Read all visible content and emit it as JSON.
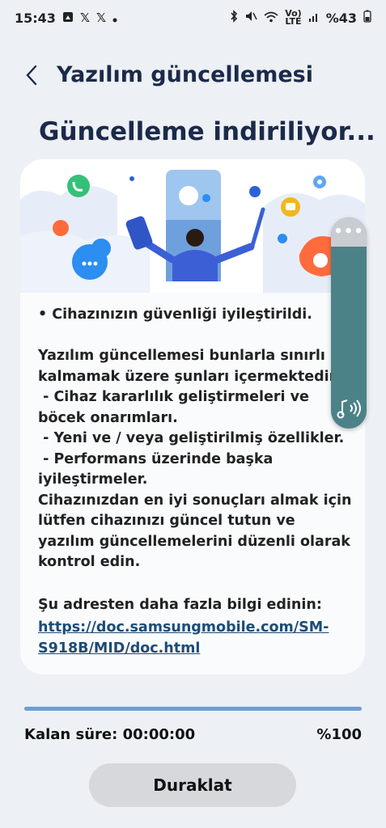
{
  "status_bar": {
    "time": "15:43",
    "battery_percent": "%43",
    "network_label_top": "Vo)",
    "network_label_bottom": "LTE",
    "icons": [
      "photo-icon",
      "x-app-icon",
      "x-app-icon",
      "dot-icon",
      "bluetooth-icon",
      "mute-icon",
      "wifi-icon",
      "signal-icon",
      "battery-icon"
    ]
  },
  "header": {
    "back_icon": "chevron-left-icon",
    "title": "Yazılım güncellemesi"
  },
  "main": {
    "status_heading": "Güncelleme indiriliyor...",
    "description": "• Cihazınızın güvenliği iyileştirildi.\n\nYazılım güncellemesi bunlarla sınırlı kalmamak üzere şunları içermektedir\n - Cihaz kararlılık geliştirmeleri ve böcek onarımları.\n - Yeni ve / veya geliştirilmiş özellikler.\n - Performans üzerinde başka iyileştirmeler.\nCihazınızdan en iyi sonuçları almak için lütfen cihazınızı güncel tutun ve yazılım güncellemelerini düzenli olarak kontrol edin.",
    "more_info_label": "Şu adresten daha fazla bilgi edinin:",
    "link": "https://doc.samsungmobile.com/SM-S918B/MID/doc.html"
  },
  "floating_panel": {
    "menu_icon": "more-dots-icon",
    "sound_icon": "sound-wave-icon",
    "color": "#4b8287"
  },
  "progress": {
    "value_percent": 100,
    "remaining_label": "Kalan süre: 00:00:00",
    "percent_label": "%100"
  },
  "footer": {
    "pause_label": "Duraklat"
  },
  "colors": {
    "background": "#edf0f4",
    "card": "#fafbfc",
    "title": "#1b2a4a",
    "link": "#1c4c78",
    "progress_fill": "#6f9ed4",
    "button": "#d6d8db"
  }
}
